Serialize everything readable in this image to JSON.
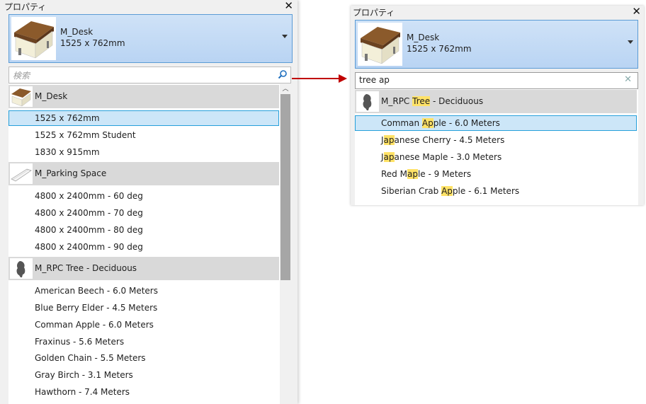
{
  "left_panel": {
    "title": "プロパティ",
    "selector": {
      "name": "M_Desk",
      "size": "1525 x 762mm"
    },
    "search": {
      "placeholder": "検索"
    },
    "groups": [
      {
        "label": "M_Desk",
        "items": [
          "1525 x 762mm",
          "1525 x 762mm Student",
          "1830 x 915mm"
        ]
      },
      {
        "label": "M_Parking Space",
        "items": [
          "4800 x 2400mm - 60 deg",
          "4800 x 2400mm - 70 deg",
          "4800 x 2400mm - 80 deg",
          "4800 x 2400mm - 90 deg"
        ]
      },
      {
        "label": "M_RPC Tree - Deciduous",
        "items": [
          "American Beech - 6.0 Meters",
          "Blue Berry Elder - 4.5 Meters",
          "Comman Apple - 6.0 Meters",
          "Fraxinus - 5.6 Meters",
          "Golden Chain - 5.5 Meters",
          "Gray Birch - 3.1 Meters",
          "Hawthorn - 7.4 Meters"
        ]
      }
    ],
    "selected_item": "1525 x 762mm"
  },
  "right_panel": {
    "title": "プロパティ",
    "selector": {
      "name": "M_Desk",
      "size": "1525 x 762mm"
    },
    "search": {
      "value": "tree ap"
    },
    "group": {
      "pre": "M_RPC ",
      "hl": "Tree",
      "post": " - Deciduous"
    },
    "items": [
      {
        "pre": "Comman ",
        "hl": "Ap",
        "post": "ple - 6.0 Meters"
      },
      {
        "pre": "J",
        "hl": "ap",
        "post": "anese Cherry - 4.5 Meters"
      },
      {
        "pre": "J",
        "hl": "ap",
        "post": "anese Maple - 3.0 Meters"
      },
      {
        "pre": "Red M",
        "hl": "ap",
        "post": "le - 9 Meters"
      },
      {
        "pre": "Siberian Crab ",
        "hl": "Ap",
        "post": "ple - 6.1 Meters"
      }
    ]
  },
  "colors": {
    "selector_bg": "#b9d4f3",
    "selected_row": "#cce6f8",
    "highlight": "#ffe267",
    "group_bg": "#d9d9d9",
    "arrow": "#c00000"
  }
}
